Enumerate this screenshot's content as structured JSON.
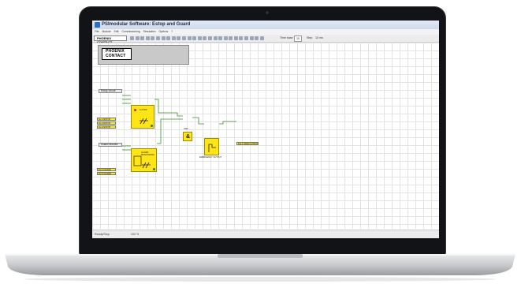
{
  "window": {
    "title": "PSImodular Software: Estop and Guard"
  },
  "menu": [
    "File",
    "Module",
    "Edit",
    "Commissioning",
    "Simulation",
    "Options",
    "?"
  ],
  "toolbar": {
    "logo": "PHOENIX CONTACT",
    "time_base_label": "Time base",
    "time_base_value": "10",
    "step_label": "Step",
    "step_value": "10 ms"
  },
  "canvas": {
    "logo_lines": [
      "PHOENIX",
      "CONTACT"
    ],
    "groups": [
      {
        "label": "Estop circuit"
      },
      {
        "label": "Guard Monitor"
      }
    ],
    "estop_block": {
      "label": "E-STOP",
      "inputs": [
        "Inp 1 ESTOP",
        "Inp 2 ESTOP",
        "Inp 3 ESTOP"
      ]
    },
    "guard_block": {
      "label": "GUARD MONITORING",
      "inputs": [
        "Inp 4 GUARD",
        "Inp 5 GUARD"
      ]
    },
    "and_block": {
      "symbol": "&",
      "label": "AND"
    },
    "delay_block": {
      "label": "EMERGENCY OUTPUT"
    },
    "output": {
      "label": "Out 1 SAFE OUTPUT"
    }
  },
  "statusbar": {
    "left": "Ready/Stop",
    "right": "100 %"
  },
  "colors": {
    "block_fill": "#ffe416",
    "wire": "#3c8c2c",
    "titlebar": "#cdd9ea",
    "laptop_bezel": "#121316"
  }
}
